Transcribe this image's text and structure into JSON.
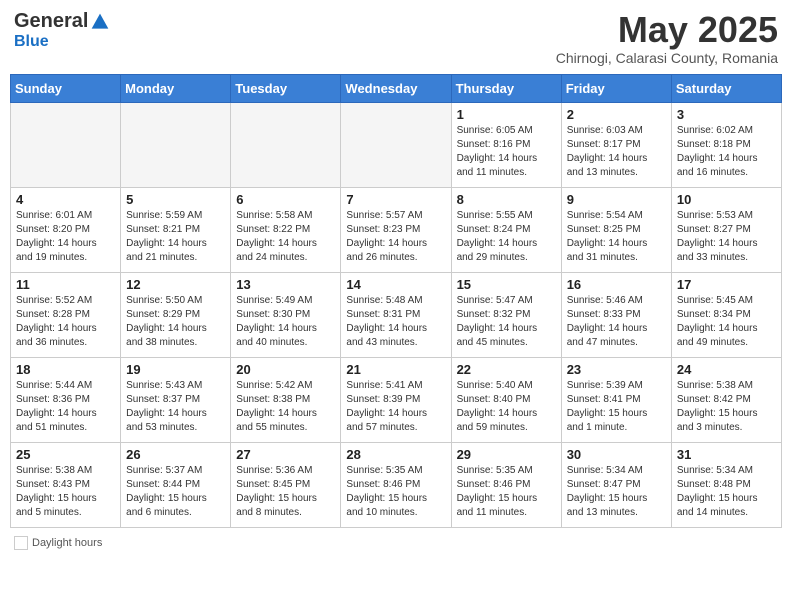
{
  "header": {
    "logo_general": "General",
    "logo_blue": "Blue",
    "month_title": "May 2025",
    "subtitle": "Chirnogi, Calarasi County, Romania"
  },
  "days_of_week": [
    "Sunday",
    "Monday",
    "Tuesday",
    "Wednesday",
    "Thursday",
    "Friday",
    "Saturday"
  ],
  "weeks": [
    [
      {
        "day": "",
        "info": ""
      },
      {
        "day": "",
        "info": ""
      },
      {
        "day": "",
        "info": ""
      },
      {
        "day": "",
        "info": ""
      },
      {
        "day": "1",
        "info": "Sunrise: 6:05 AM\nSunset: 8:16 PM\nDaylight: 14 hours and 11 minutes."
      },
      {
        "day": "2",
        "info": "Sunrise: 6:03 AM\nSunset: 8:17 PM\nDaylight: 14 hours and 13 minutes."
      },
      {
        "day": "3",
        "info": "Sunrise: 6:02 AM\nSunset: 8:18 PM\nDaylight: 14 hours and 16 minutes."
      }
    ],
    [
      {
        "day": "4",
        "info": "Sunrise: 6:01 AM\nSunset: 8:20 PM\nDaylight: 14 hours and 19 minutes."
      },
      {
        "day": "5",
        "info": "Sunrise: 5:59 AM\nSunset: 8:21 PM\nDaylight: 14 hours and 21 minutes."
      },
      {
        "day": "6",
        "info": "Sunrise: 5:58 AM\nSunset: 8:22 PM\nDaylight: 14 hours and 24 minutes."
      },
      {
        "day": "7",
        "info": "Sunrise: 5:57 AM\nSunset: 8:23 PM\nDaylight: 14 hours and 26 minutes."
      },
      {
        "day": "8",
        "info": "Sunrise: 5:55 AM\nSunset: 8:24 PM\nDaylight: 14 hours and 29 minutes."
      },
      {
        "day": "9",
        "info": "Sunrise: 5:54 AM\nSunset: 8:25 PM\nDaylight: 14 hours and 31 minutes."
      },
      {
        "day": "10",
        "info": "Sunrise: 5:53 AM\nSunset: 8:27 PM\nDaylight: 14 hours and 33 minutes."
      }
    ],
    [
      {
        "day": "11",
        "info": "Sunrise: 5:52 AM\nSunset: 8:28 PM\nDaylight: 14 hours and 36 minutes."
      },
      {
        "day": "12",
        "info": "Sunrise: 5:50 AM\nSunset: 8:29 PM\nDaylight: 14 hours and 38 minutes."
      },
      {
        "day": "13",
        "info": "Sunrise: 5:49 AM\nSunset: 8:30 PM\nDaylight: 14 hours and 40 minutes."
      },
      {
        "day": "14",
        "info": "Sunrise: 5:48 AM\nSunset: 8:31 PM\nDaylight: 14 hours and 43 minutes."
      },
      {
        "day": "15",
        "info": "Sunrise: 5:47 AM\nSunset: 8:32 PM\nDaylight: 14 hours and 45 minutes."
      },
      {
        "day": "16",
        "info": "Sunrise: 5:46 AM\nSunset: 8:33 PM\nDaylight: 14 hours and 47 minutes."
      },
      {
        "day": "17",
        "info": "Sunrise: 5:45 AM\nSunset: 8:34 PM\nDaylight: 14 hours and 49 minutes."
      }
    ],
    [
      {
        "day": "18",
        "info": "Sunrise: 5:44 AM\nSunset: 8:36 PM\nDaylight: 14 hours and 51 minutes."
      },
      {
        "day": "19",
        "info": "Sunrise: 5:43 AM\nSunset: 8:37 PM\nDaylight: 14 hours and 53 minutes."
      },
      {
        "day": "20",
        "info": "Sunrise: 5:42 AM\nSunset: 8:38 PM\nDaylight: 14 hours and 55 minutes."
      },
      {
        "day": "21",
        "info": "Sunrise: 5:41 AM\nSunset: 8:39 PM\nDaylight: 14 hours and 57 minutes."
      },
      {
        "day": "22",
        "info": "Sunrise: 5:40 AM\nSunset: 8:40 PM\nDaylight: 14 hours and 59 minutes."
      },
      {
        "day": "23",
        "info": "Sunrise: 5:39 AM\nSunset: 8:41 PM\nDaylight: 15 hours and 1 minute."
      },
      {
        "day": "24",
        "info": "Sunrise: 5:38 AM\nSunset: 8:42 PM\nDaylight: 15 hours and 3 minutes."
      }
    ],
    [
      {
        "day": "25",
        "info": "Sunrise: 5:38 AM\nSunset: 8:43 PM\nDaylight: 15 hours and 5 minutes."
      },
      {
        "day": "26",
        "info": "Sunrise: 5:37 AM\nSunset: 8:44 PM\nDaylight: 15 hours and 6 minutes."
      },
      {
        "day": "27",
        "info": "Sunrise: 5:36 AM\nSunset: 8:45 PM\nDaylight: 15 hours and 8 minutes."
      },
      {
        "day": "28",
        "info": "Sunrise: 5:35 AM\nSunset: 8:46 PM\nDaylight: 15 hours and 10 minutes."
      },
      {
        "day": "29",
        "info": "Sunrise: 5:35 AM\nSunset: 8:46 PM\nDaylight: 15 hours and 11 minutes."
      },
      {
        "day": "30",
        "info": "Sunrise: 5:34 AM\nSunset: 8:47 PM\nDaylight: 15 hours and 13 minutes."
      },
      {
        "day": "31",
        "info": "Sunrise: 5:34 AM\nSunset: 8:48 PM\nDaylight: 15 hours and 14 minutes."
      }
    ]
  ],
  "legend": {
    "daylight_label": "Daylight hours"
  }
}
